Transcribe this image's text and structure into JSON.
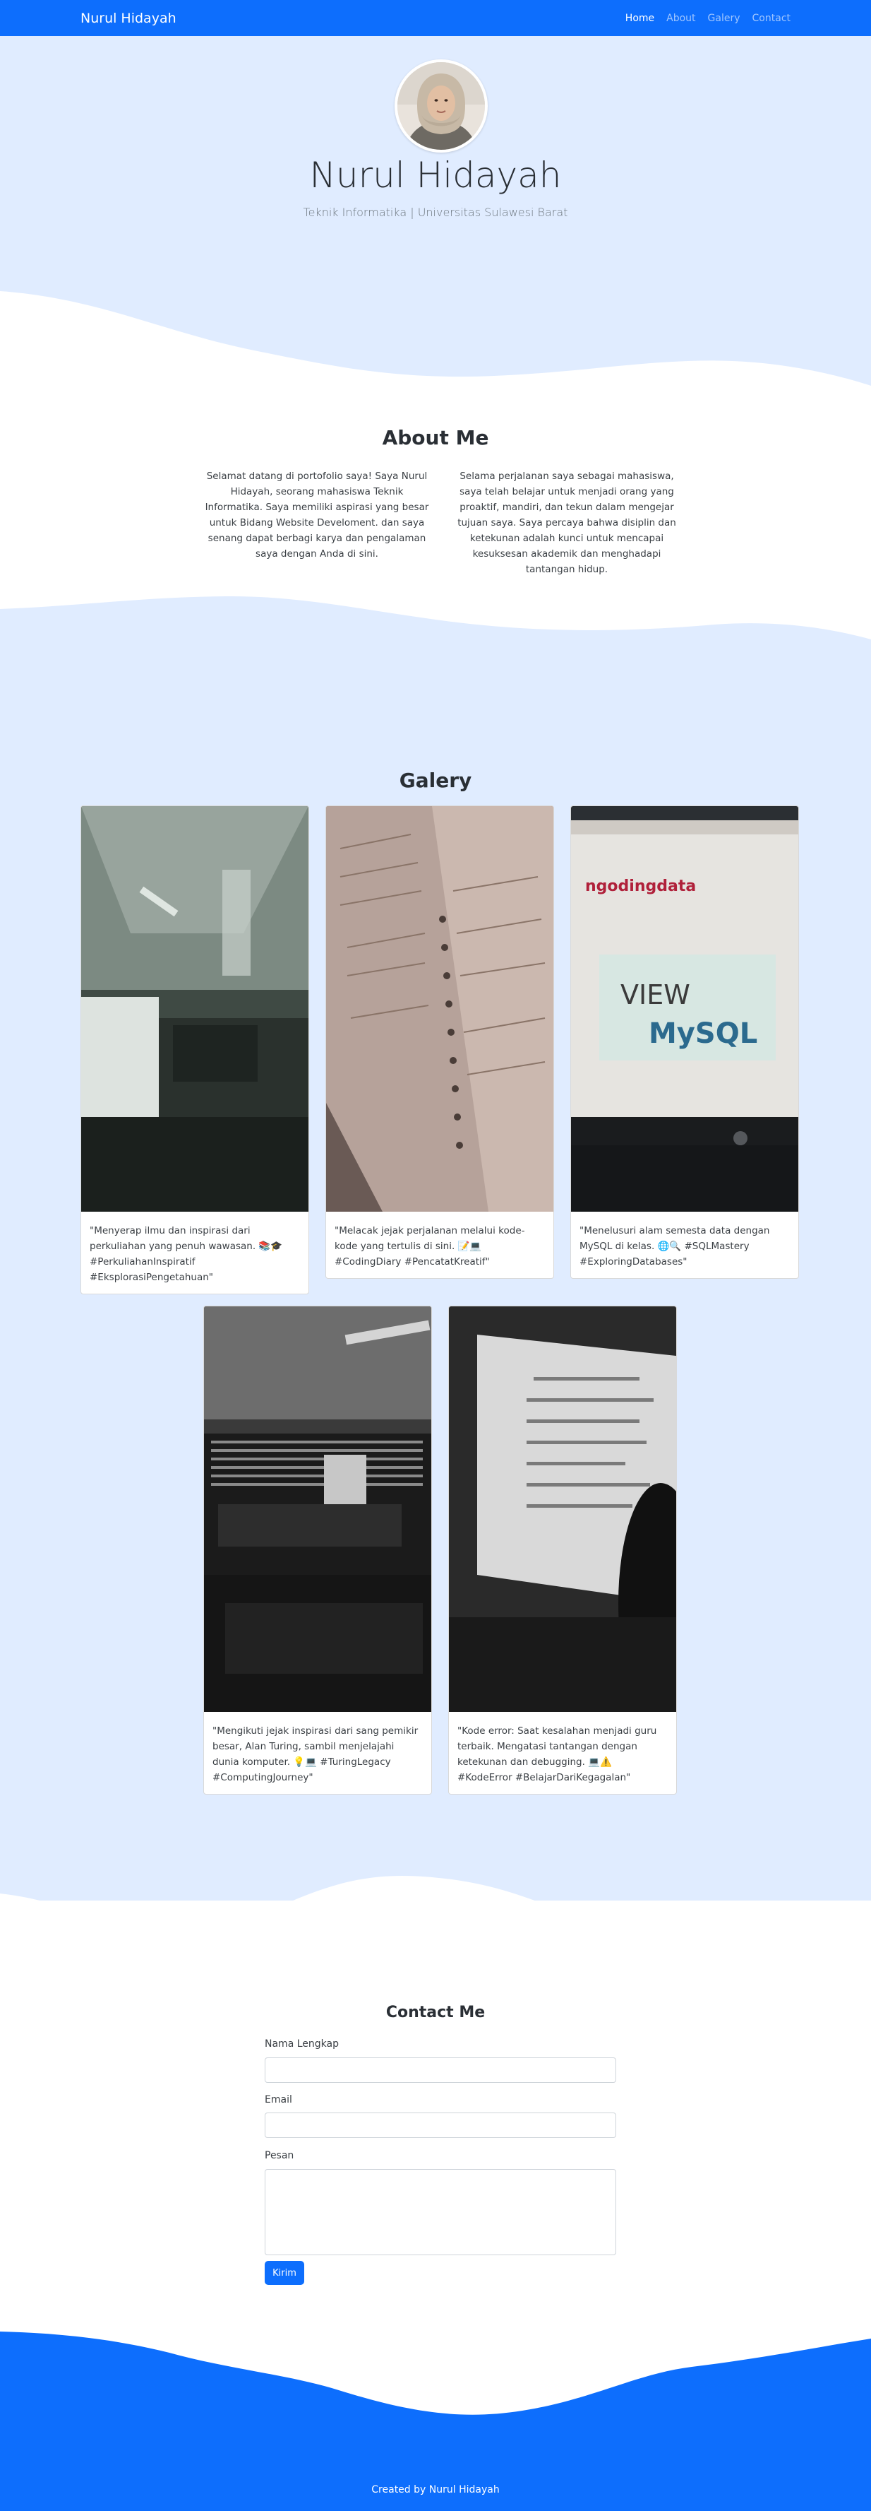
{
  "navbar": {
    "brand": "Nurul Hidayah",
    "links": [
      {
        "label": "Home"
      },
      {
        "label": "About"
      },
      {
        "label": "Galery"
      },
      {
        "label": "Contact"
      }
    ]
  },
  "hero": {
    "name": "Nurul Hidayah",
    "subtitle": "Teknik Informatika | Universitas Sulawesi Barat"
  },
  "about": {
    "title": "About Me",
    "col1": "Selamat datang di portofolio saya! Saya Nurul Hidayah, seorang mahasiswa Teknik Informatika. Saya memiliki aspirasi yang besar untuk Bidang Website Develoment. dan saya senang dapat berbagi karya dan pengalaman saya dengan Anda di sini.",
    "col2": "Selama perjalanan saya sebagai mahasiswa, saya telah belajar untuk menjadi orang yang proaktif, mandiri, dan tekun dalam mengejar tujuan saya. Saya percaya bahwa disiplin dan ketekunan adalah kunci untuk mencapai kesuksesan akademik dan menghadapi tantangan hidup."
  },
  "gallery": {
    "title": "Galery",
    "cards": [
      {
        "caption": "\"Menyerap ilmu dan inspirasi dari perkuliahan yang penuh wawasan. 📚🎓 #PerkuliahanInspiratif #EksplorasiPengetahuan\""
      },
      {
        "caption": "\"Melacak jejak perjalanan melalui kode-kode yang tertulis di sini. 📝💻 #CodingDiary #PencatatKreatif\""
      },
      {
        "caption": "\"Menelusuri alam semesta data dengan MySQL di kelas. 🌐🔍 #SQLMastery #ExploringDatabases\""
      },
      {
        "caption": "\"Mengikuti jejak inspirasi dari sang pemikir besar, Alan Turing, sambil menjelajahi dunia komputer. 💡💻 #TuringLegacy #ComputingJourney\""
      },
      {
        "caption": "\"Kode error: Saat kesalahan menjadi guru terbaik. Mengatasi tantangan dengan ketekunan dan debugging. 💻⚠️ #KodeError #BelajarDariKegagalan\""
      }
    ],
    "mysql_screen": {
      "site": "ngodingdata",
      "view": "VIEW",
      "brand": "MySQL"
    }
  },
  "contact": {
    "title": "Contact Me",
    "name_label": "Nama Lengkap",
    "email_label": "Email",
    "message_label": "Pesan",
    "submit_label": "Kirim"
  },
  "footer": {
    "text": "Created by Nurul Hidayah"
  },
  "colors": {
    "primary": "#0d6efd",
    "light_bg": "#e0ecff"
  }
}
